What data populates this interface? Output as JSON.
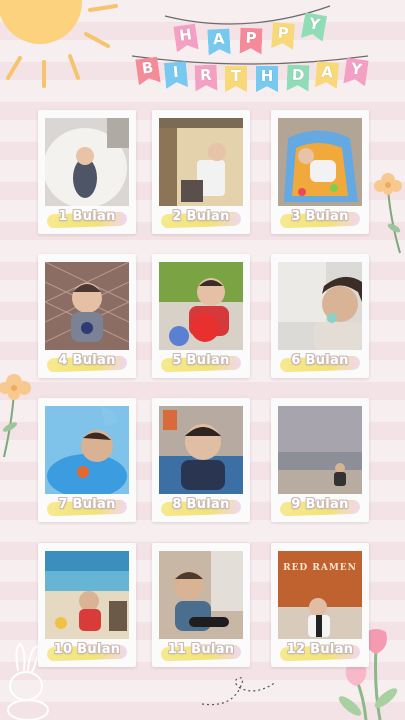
{
  "banner": {
    "line1": [
      "H",
      "A",
      "P",
      "P",
      "Y"
    ],
    "line2": [
      "B",
      "I",
      "R",
      "T",
      "H",
      "D",
      "A",
      "Y"
    ],
    "colors1": [
      "#f4a0c4",
      "#78c9ef",
      "#f58a98",
      "#f8d878",
      "#8fdcb7"
    ],
    "colors2": [
      "#f58a98",
      "#78c9ef",
      "#f4a0c4",
      "#f8d878",
      "#78c9ef",
      "#8fdcb7",
      "#f8d878",
      "#f4a0c4"
    ]
  },
  "cards": [
    {
      "label": "1 Bulan",
      "scene": "blanket"
    },
    {
      "label": "2 Bulan",
      "scene": "crib"
    },
    {
      "label": "3 Bulan",
      "scene": "bouncer"
    },
    {
      "label": "4 Bulan",
      "scene": "sitting"
    },
    {
      "label": "5 Bulan",
      "scene": "ball"
    },
    {
      "label": "6 Bulan",
      "scene": "window"
    },
    {
      "label": "7 Bulan",
      "scene": "float"
    },
    {
      "label": "8 Bulan",
      "scene": "crawl"
    },
    {
      "label": "9 Bulan",
      "scene": "beach"
    },
    {
      "label": "10 Bulan",
      "scene": "playground"
    },
    {
      "label": "11 Bulan",
      "scene": "toy"
    },
    {
      "label": "12 Bulan",
      "scene": "movie"
    }
  ],
  "movie_poster_text": "RED  RAMEN"
}
